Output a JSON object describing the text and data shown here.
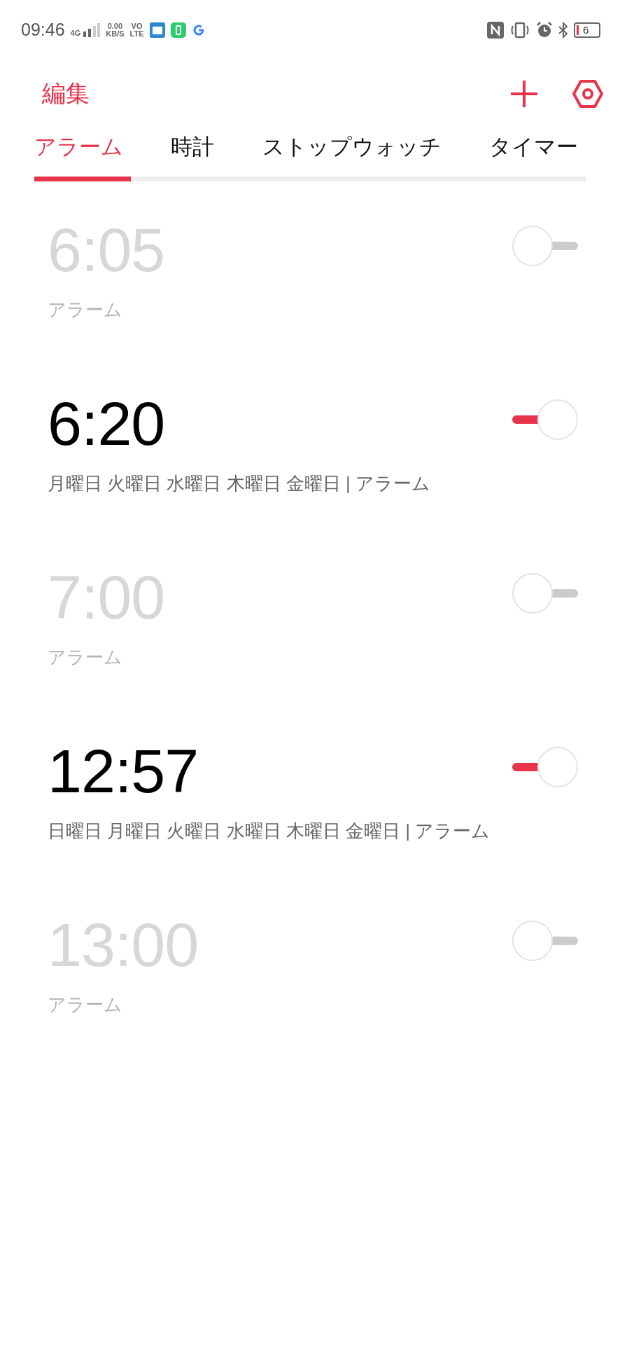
{
  "status_bar": {
    "time": "09:46",
    "network": "4G",
    "speed": "0.00",
    "speed_unit": "KB/S",
    "volte_top": "VO",
    "volte_bottom": "LTE",
    "battery": "6"
  },
  "header": {
    "edit": "編集"
  },
  "tabs": [
    {
      "label": "アラーム",
      "selected": true
    },
    {
      "label": "時計",
      "selected": false
    },
    {
      "label": "ストップウォッチ",
      "selected": false
    },
    {
      "label": "タイマー",
      "selected": false
    }
  ],
  "alarms": [
    {
      "time": "6:05",
      "label": "アラーム",
      "on": false
    },
    {
      "time": "6:20",
      "label": "月曜日 火曜日 水曜日 木曜日 金曜日 | アラーム",
      "on": true
    },
    {
      "time": "7:00",
      "label": "アラーム",
      "on": false
    },
    {
      "time": "12:57",
      "label": "日曜日 月曜日 火曜日 水曜日 木曜日 金曜日 | アラーム",
      "on": true
    },
    {
      "time": "13:00",
      "label": "アラーム",
      "on": false
    }
  ]
}
